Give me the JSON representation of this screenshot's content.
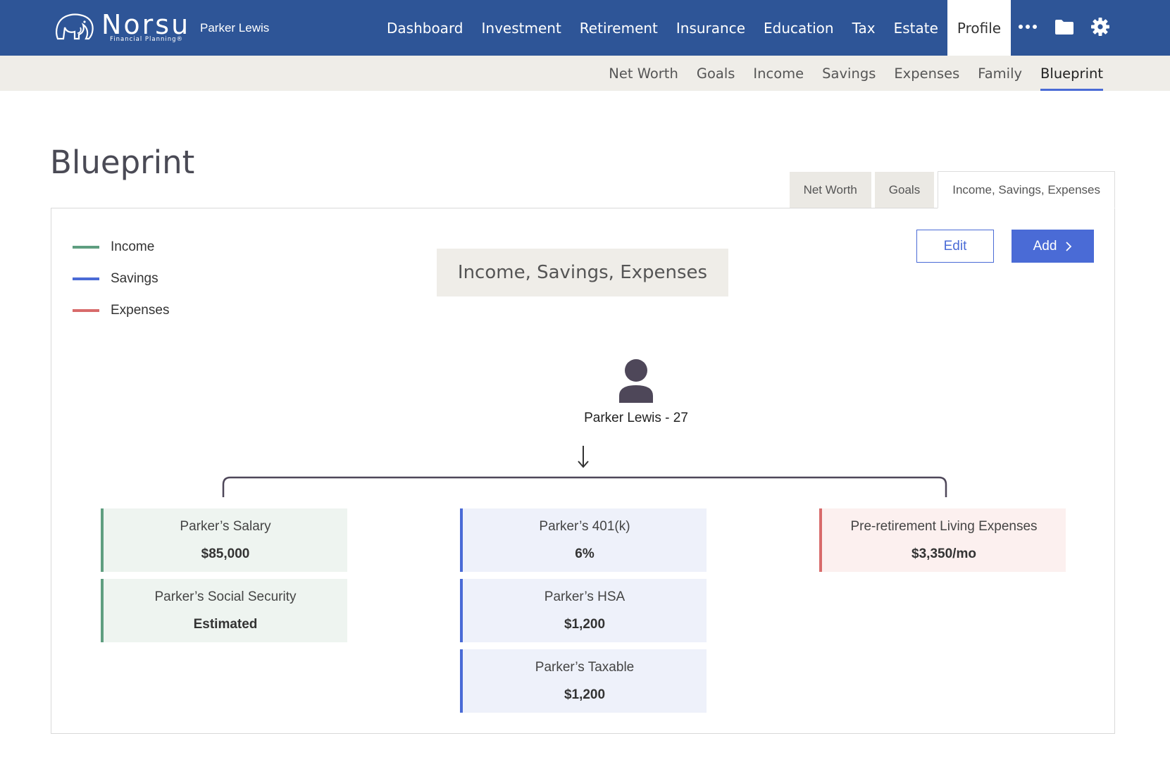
{
  "colors": {
    "topbar": "#2e5597",
    "accent": "#4a6bd6",
    "income": "#5f9e80",
    "savings": "#4a6bd6",
    "expenses": "#d86b6b"
  },
  "brand": {
    "name": "Norsu",
    "tagline": "Financial Planning®",
    "icon": "elephant-logo"
  },
  "header": {
    "user_name": "Parker Lewis"
  },
  "main_nav": [
    "Dashboard",
    "Investment",
    "Retirement",
    "Insurance",
    "Education",
    "Tax",
    "Estate",
    "Profile"
  ],
  "main_nav_active": "Profile",
  "nav_icons": [
    "more-icon",
    "folder-icon",
    "gear-icon"
  ],
  "sub_nav": [
    "Net Worth",
    "Goals",
    "Income",
    "Savings",
    "Expenses",
    "Family",
    "Blueprint"
  ],
  "sub_nav_active": "Blueprint",
  "page": {
    "title": "Blueprint"
  },
  "tabs": [
    "Net Worth",
    "Goals",
    "Income, Savings, Expenses"
  ],
  "tabs_active": "Income, Savings, Expenses",
  "legend": [
    {
      "label": "Income",
      "color": "#5f9e80"
    },
    {
      "label": "Savings",
      "color": "#4a6bd6"
    },
    {
      "label": "Expenses",
      "color": "#d86b6b"
    }
  ],
  "diagram": {
    "title": "Income, Savings, Expenses",
    "person": "Parker Lewis - 27",
    "income": [
      {
        "title": "Parker’s Salary",
        "value": "$85,000"
      },
      {
        "title": "Parker’s Social Security",
        "value": "Estimated"
      }
    ],
    "savings": [
      {
        "title": "Parker’s 401(k)",
        "value": "6%"
      },
      {
        "title": "Parker’s HSA",
        "value": "$1,200"
      },
      {
        "title": "Parker’s Taxable",
        "value": "$1,200"
      }
    ],
    "expenses": [
      {
        "title": "Pre-retirement Living Expenses",
        "value": "$3,350/mo"
      }
    ]
  },
  "actions": {
    "edit": "Edit",
    "add": "Add"
  }
}
